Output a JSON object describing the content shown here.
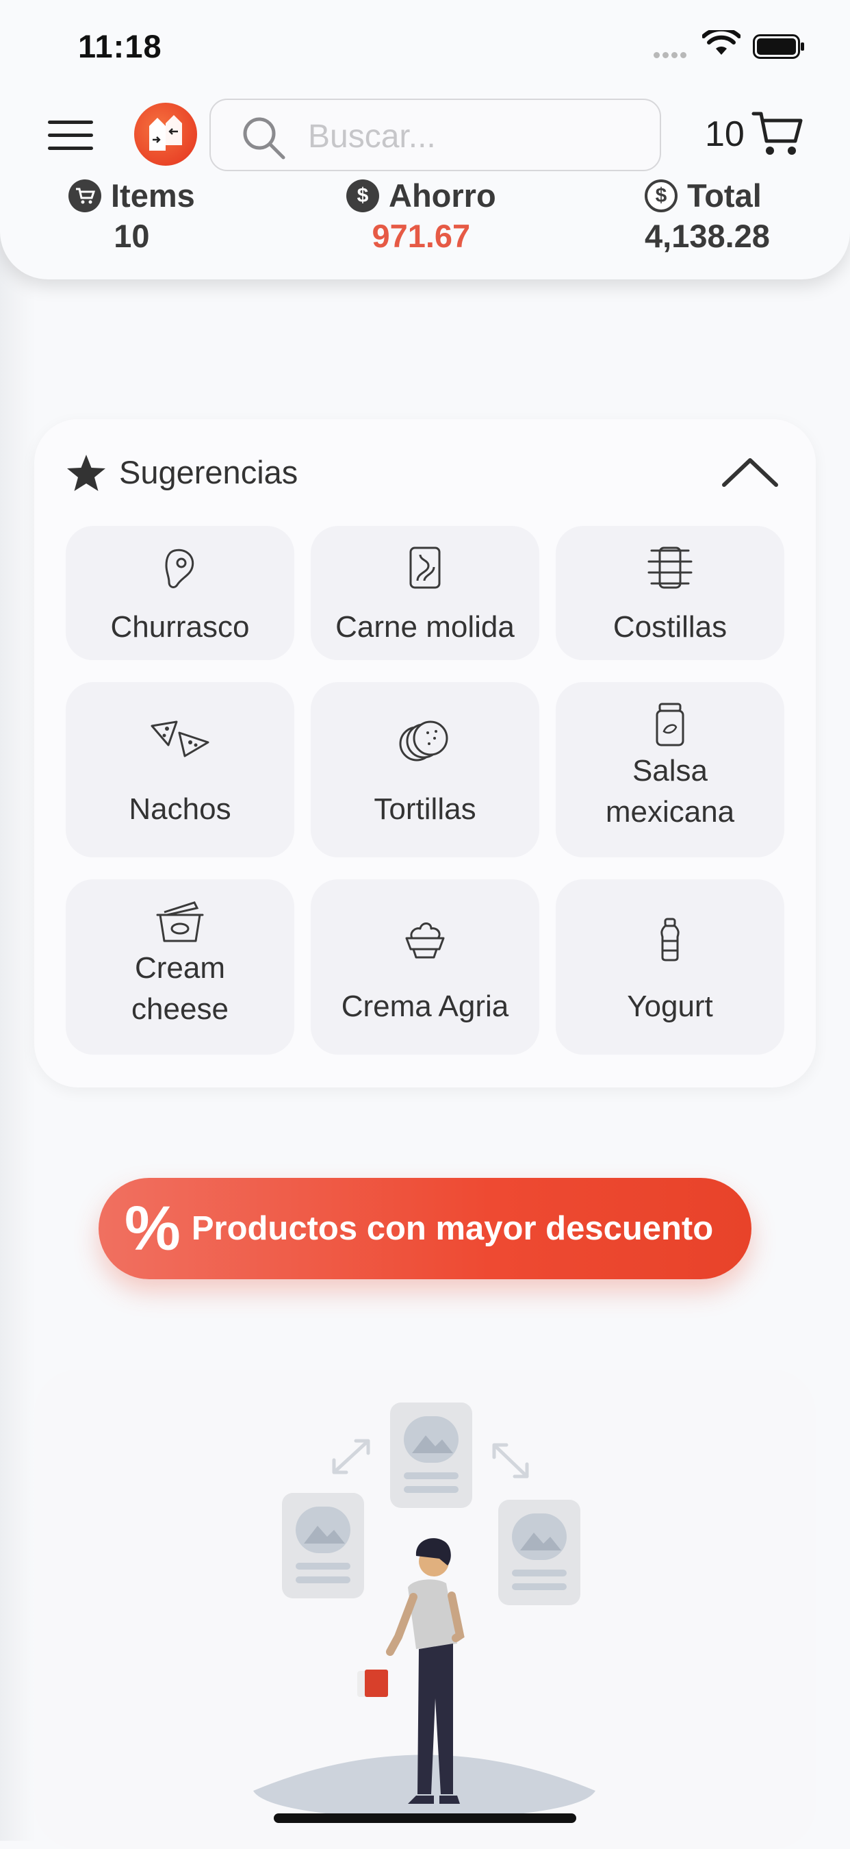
{
  "status_bar": {
    "time": "11:18"
  },
  "header": {
    "search": {
      "placeholder": "Buscar..."
    },
    "cart_count": "10",
    "stats": {
      "items": {
        "label": "Items",
        "value": "10"
      },
      "savings": {
        "label": "Ahorro",
        "value": "971.67"
      },
      "total": {
        "label": "Total",
        "value": "4,138.28"
      }
    }
  },
  "suggestions": {
    "title": "Sugerencias",
    "items": [
      {
        "label": "Churrasco",
        "icon": "steak-icon"
      },
      {
        "label": "Carne molida",
        "icon": "ground-meat-icon"
      },
      {
        "label": "Costillas",
        "icon": "ribs-icon"
      },
      {
        "label": "Nachos",
        "icon": "nachos-icon"
      },
      {
        "label": "Tortillas",
        "icon": "tortillas-icon"
      },
      {
        "label": "Salsa mexicana",
        "line1": "Salsa",
        "line2": "mexicana",
        "icon": "salsa-jar-icon"
      },
      {
        "label": "Cream cheese",
        "line1": "Cream",
        "line2": "cheese",
        "icon": "cream-cheese-icon"
      },
      {
        "label": "Crema Agria",
        "icon": "sour-cream-icon"
      },
      {
        "label": "Yogurt",
        "icon": "yogurt-bottle-icon"
      }
    ]
  },
  "discount_button": {
    "symbol": "%",
    "label": "Productos con mayor descuento"
  },
  "colors": {
    "accent": "#ee4a32",
    "savings": "#e65a45",
    "tile_bg": "#f2f2f6"
  }
}
